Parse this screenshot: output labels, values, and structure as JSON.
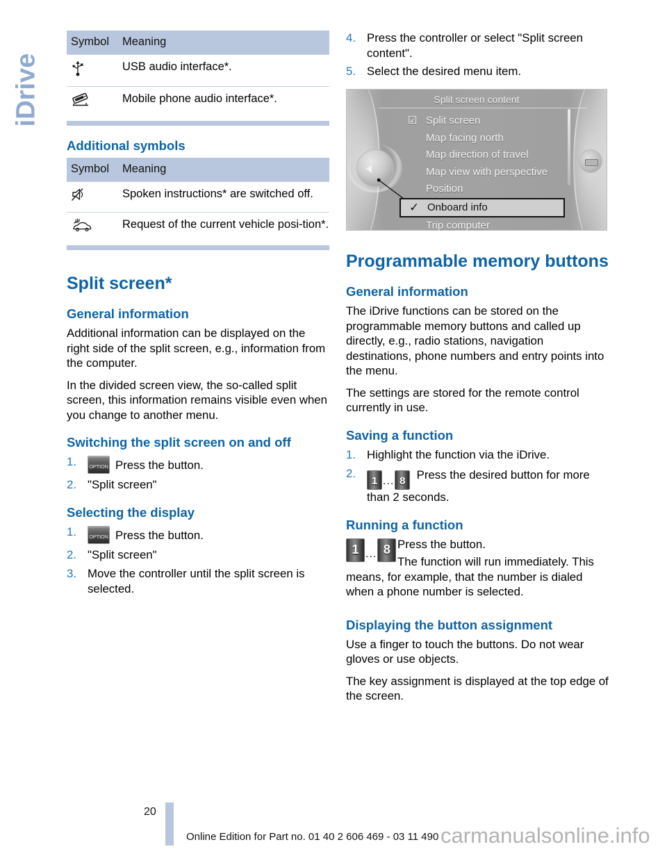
{
  "side_tab": {
    "label": "iDrive"
  },
  "left": {
    "table_interfaces": {
      "headers": [
        "Symbol",
        "Meaning"
      ],
      "rows": [
        {
          "icon": "usb-icon",
          "meaning": "USB audio interface*."
        },
        {
          "icon": "mobile-phone-audio-icon",
          "meaning": "Mobile phone audio interface*."
        }
      ]
    },
    "additional_symbols_heading": "Additional symbols",
    "table_additional": {
      "headers": [
        "Symbol",
        "Meaning"
      ],
      "rows": [
        {
          "icon": "speaker-muted-icon",
          "meaning": "Spoken instructions* are switched off."
        },
        {
          "icon": "vehicle-position-icon",
          "meaning": "Request of the current vehicle posi-tion*."
        }
      ]
    },
    "split_screen": {
      "title": "Split screen*",
      "general_information": {
        "heading": "General information",
        "paragraphs": [
          "Additional information can be displayed on the right side of the split screen, e.g., information from the computer.",
          "In the divided screen view, the so-called split screen, this information remains visible even when you change to another menu."
        ]
      },
      "switching": {
        "heading": "Switching the split screen on and off",
        "steps": [
          {
            "num": "1.",
            "button": "OPTION",
            "text": "Press the button."
          },
          {
            "num": "2.",
            "text": "\"Split screen\""
          }
        ]
      },
      "selecting": {
        "heading": "Selecting the display",
        "steps": [
          {
            "num": "1.",
            "button": "OPTION",
            "text": "Press the button."
          },
          {
            "num": "2.",
            "text": "\"Split screen\""
          },
          {
            "num": "3.",
            "text": "Move the controller until the split screen is selected."
          }
        ]
      }
    }
  },
  "right": {
    "continued_steps": [
      {
        "num": "4.",
        "text": "Press the controller or select \"Split screen content\"."
      },
      {
        "num": "5.",
        "text": "Select the desired menu item."
      }
    ],
    "idrive_screen": {
      "title": "Split screen content",
      "items": [
        {
          "label": "Split screen",
          "mark": "checkbox-checked",
          "selected": false
        },
        {
          "label": "Map facing north",
          "mark": "",
          "selected": false
        },
        {
          "label": "Map direction of travel",
          "mark": "",
          "selected": false
        },
        {
          "label": "Map view with perspective",
          "mark": "",
          "selected": false
        },
        {
          "label": "Position",
          "mark": "",
          "selected": false
        },
        {
          "label": "Onboard info",
          "mark": "check",
          "selected": true
        },
        {
          "label": "Trip computer",
          "mark": "",
          "selected": false
        }
      ]
    },
    "programmable": {
      "title": "Programmable memory buttons",
      "general_information": {
        "heading": "General information",
        "paragraphs": [
          "The iDrive functions can be stored on the programmable memory buttons and called up directly, e.g., radio stations, navigation destinations, phone numbers and entry points into the menu.",
          "The settings are stored for the remote control currently in use."
        ]
      },
      "saving": {
        "heading": "Saving a function",
        "steps": [
          {
            "num": "1.",
            "text": "Highlight the function via the iDrive."
          },
          {
            "num": "2.",
            "buttons": [
              "1",
              "8"
            ],
            "dots": "...",
            "text": "Press the desired button for more than 2 seconds."
          }
        ]
      },
      "running": {
        "heading": "Running a function",
        "buttons": [
          "1",
          "8"
        ],
        "dots": "...",
        "line1": "Press the button.",
        "line2": "The function will run immediately. This",
        "line3": "means, for example, that the number is dialed when a phone number is selected."
      },
      "displaying": {
        "heading": "Displaying the button assignment",
        "paragraphs": [
          "Use a finger to touch the buttons. Do not wear gloves or use objects.",
          "The key assignment is displayed at the top edge of the screen."
        ]
      }
    }
  },
  "footer": {
    "page_number": "20",
    "text": "Online Edition for Part no. 01 40 2 606 469 - 03 11 490",
    "watermark": "carmanualsonline.info"
  },
  "colors": {
    "heading_blue": "#0d63a5",
    "table_header_bg": "#b9c7de",
    "side_tab_blue": "#90aace",
    "step_number_blue": "#2277bb"
  }
}
